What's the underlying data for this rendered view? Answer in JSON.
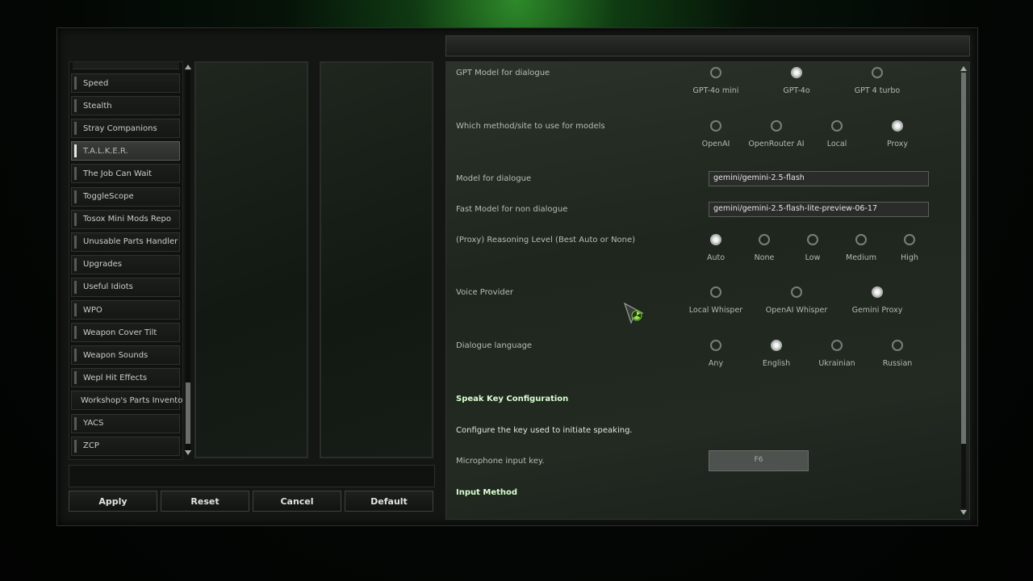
{
  "mods": {
    "items": [
      {
        "label": "Speed"
      },
      {
        "label": "Stealth"
      },
      {
        "label": "Stray Companions"
      },
      {
        "label": "T.A.L.K.E.R.",
        "selected": true
      },
      {
        "label": "The Job Can Wait"
      },
      {
        "label": "ToggleScope"
      },
      {
        "label": "Tosox Mini Mods Repo"
      },
      {
        "label": "Unusable Parts Handler"
      },
      {
        "label": "Upgrades"
      },
      {
        "label": "Useful Idiots"
      },
      {
        "label": "WPO"
      },
      {
        "label": "Weapon Cover Tilt"
      },
      {
        "label": "Weapon Sounds"
      },
      {
        "label": "Wepl Hit Effects"
      },
      {
        "label": "Workshop's Parts Inventory"
      },
      {
        "label": "YACS"
      },
      {
        "label": "ZCP"
      }
    ]
  },
  "buttons": {
    "apply": "Apply",
    "reset": "Reset",
    "cancel": "Cancel",
    "default": "Default"
  },
  "settings": {
    "gpt_model": {
      "label": "GPT Model for dialogue",
      "options": [
        "GPT-4o mini",
        "GPT-4o",
        "GPT 4 turbo"
      ],
      "selected": "GPT-4o"
    },
    "method": {
      "label": "Which method/site to use for models",
      "options": [
        "OpenAI",
        "OpenRouter AI",
        "Local",
        "Proxy"
      ],
      "selected": "Proxy"
    },
    "model_dialogue": {
      "label": "Model for dialogue",
      "value": "gemini/gemini-2.5-flash"
    },
    "fast_model": {
      "label": "Fast Model for non dialogue",
      "value": "gemini/gemini-2.5-flash-lite-preview-06-17"
    },
    "reasoning": {
      "label": "(Proxy) Reasoning Level (Best Auto or None)",
      "options": [
        "Auto",
        "None",
        "Low",
        "Medium",
        "High"
      ],
      "selected": "Auto"
    },
    "voice": {
      "label": "Voice Provider",
      "options": [
        "Local Whisper",
        "OpenAI Whisper",
        "Gemini Proxy"
      ],
      "selected": "Gemini Proxy"
    },
    "language": {
      "label": "Dialogue language",
      "options": [
        "Any",
        "English",
        "Ukrainian",
        "Russian"
      ],
      "selected": "English"
    },
    "speak_key_header": "Speak Key Configuration",
    "speak_key_desc": "Configure the key used to initiate speaking.",
    "mic_key": {
      "label": "Microphone input key.",
      "value": "F6"
    },
    "input_method_header": "Input Method"
  },
  "colors": {
    "accent_header": "#d9ffd0",
    "selected_mod": "#e8e8e8"
  }
}
